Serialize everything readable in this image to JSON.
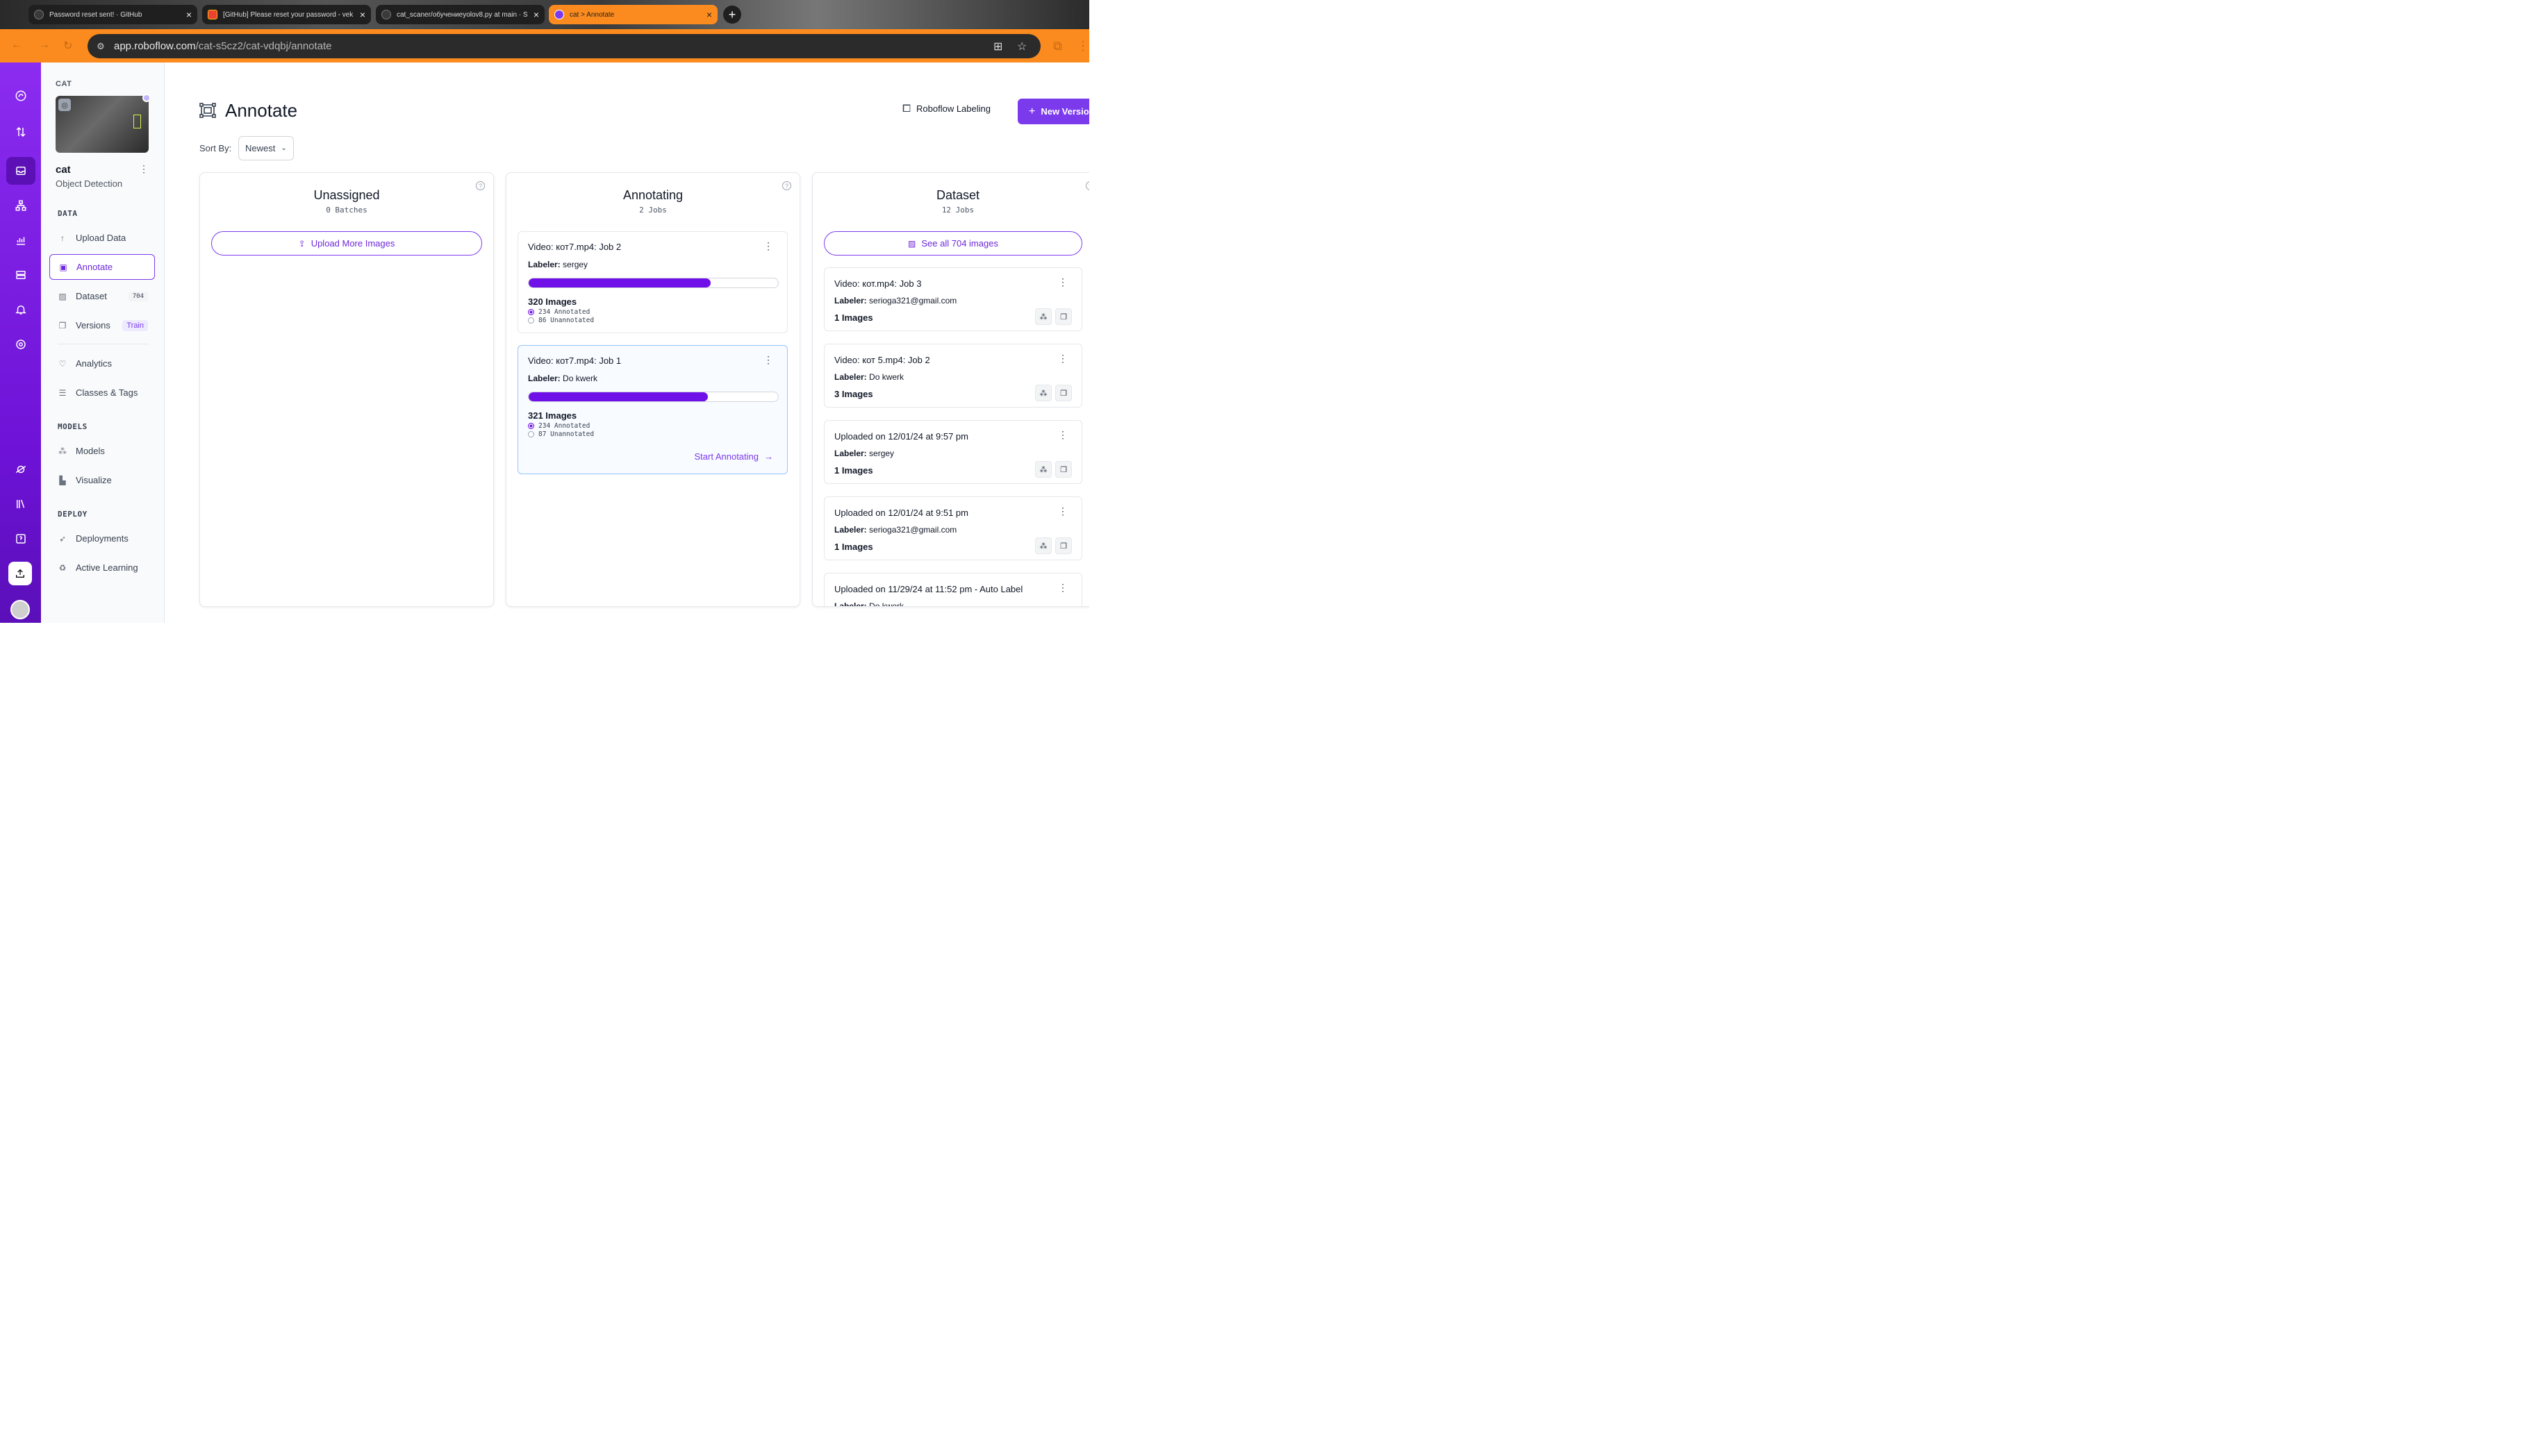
{
  "browser": {
    "tabs": [
      {
        "title": "Password reset sent! · GitHub"
      },
      {
        "title": "[GitHub] Please reset your password - vek"
      },
      {
        "title": "cat_scaner/обучениеyolov8.py at main · S"
      },
      {
        "title": "cat > Annotate"
      }
    ],
    "url_host": "app.roboflow.com",
    "url_path": "/cat-s5cz2/cat-vdqbj/annotate"
  },
  "project": {
    "section_label": "CAT",
    "name": "cat",
    "type": "Object Detection"
  },
  "sidebar": {
    "data_label": "DATA",
    "upload": "Upload Data",
    "annotate": "Annotate",
    "dataset": "Dataset",
    "dataset_badge": "704",
    "versions": "Versions",
    "versions_badge": "Train",
    "analytics": "Analytics",
    "classes": "Classes & Tags",
    "models_label": "MODELS",
    "models": "Models",
    "visualize": "Visualize",
    "deploy_label": "DEPLOY",
    "deployments": "Deployments",
    "active_learning": "Active Learning"
  },
  "header": {
    "title": "Annotate",
    "labeling_button": "Roboflow Labeling",
    "new_version_button": "New Version",
    "sort_label": "Sort By:",
    "sort_value": "Newest"
  },
  "columns": {
    "unassigned": {
      "title": "Unassigned",
      "subtitle": "0 Batches",
      "action": "Upload More Images"
    },
    "annotating": {
      "title": "Annotating",
      "subtitle": "2 Jobs",
      "jobs": [
        {
          "title": "Video: кот7.mp4: Job 2",
          "labeler_label": "Labeler:",
          "labeler": "sergey",
          "progress": 0.73,
          "images": "320 Images",
          "annotated": "234 Annotated",
          "unannotated": "86 Unannotated"
        },
        {
          "title": "Video: кот7.mp4: Job 1",
          "labeler_label": "Labeler:",
          "labeler": "Do kwerk",
          "progress": 0.72,
          "images": "321 Images",
          "annotated": "234 Annotated",
          "unannotated": "87 Unannotated",
          "action": "Start Annotating"
        }
      ]
    },
    "dataset": {
      "title": "Dataset",
      "subtitle": "12 Jobs",
      "action": "See all 704 images",
      "cards": [
        {
          "title": "Video: кот.mp4: Job 3",
          "labeler_label": "Labeler:",
          "labeler": "serioga321@gmail.com",
          "images": "1 Images"
        },
        {
          "title": "Video: кот 5.mp4: Job 2",
          "labeler_label": "Labeler:",
          "labeler": "Do kwerk",
          "images": "3 Images"
        },
        {
          "title": "Uploaded on 12/01/24 at 9:57 pm",
          "labeler_label": "Labeler:",
          "labeler": "sergey",
          "images": "1 Images"
        },
        {
          "title": "Uploaded on 12/01/24 at 9:51 pm",
          "labeler_label": "Labeler:",
          "labeler": "serioga321@gmail.com",
          "images": "1 Images"
        },
        {
          "title": "Uploaded on 11/29/24 at 11:52 pm - Auto Label",
          "labeler_label": "Labeler:",
          "labeler": "Do kwerk",
          "images": ""
        }
      ]
    }
  },
  "colors": {
    "accent": "#7c3aed",
    "progress": "#7010e8",
    "browser": "#fb8b1e"
  }
}
